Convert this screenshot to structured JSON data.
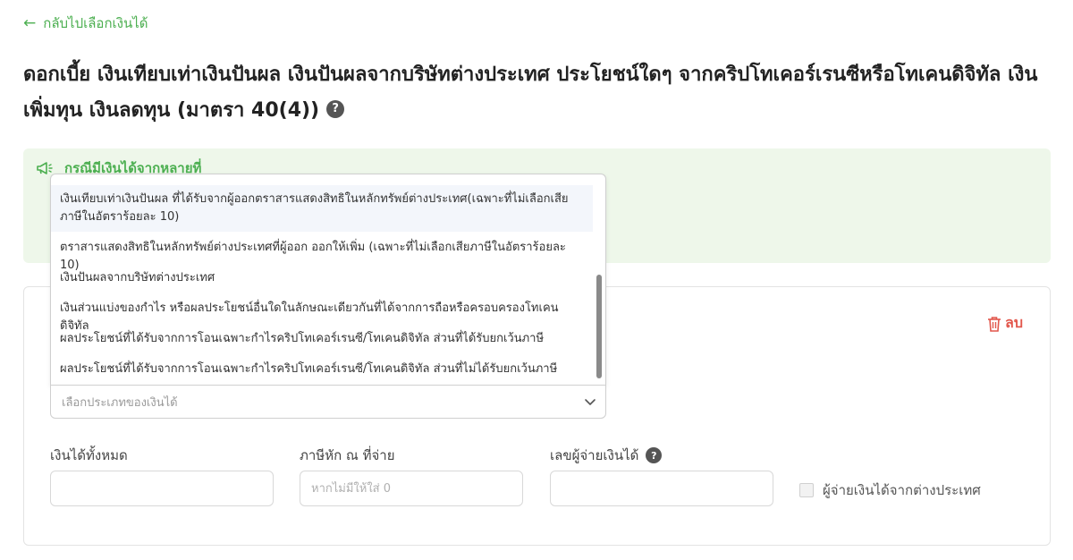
{
  "back_link": {
    "label": "กลับไปเลือกเงินได้"
  },
  "title": "ดอกเบี้ย เงินเทียบเท่าเงินปันผล เงินปันผลจากบริษัทต่างประเทศ ประโยชน์ใดๆ จากคริปโทเคอร์เรนซีหรือโทเคนดิจิทัล เงินเพิ่มทุน เงินลดทุน (มาตรา 40(4))",
  "notice": {
    "heading": "กรณีมีเงินได้จากหลายที่"
  },
  "card": {
    "delete_label": "ลบ"
  },
  "income_type": {
    "placeholder": "เลือกประเภทของเงินได้",
    "options": [
      "เงินเทียบเท่าเงินปันผล ที่ได้รับจากผู้ออกตราสารแสดงสิทธิในหลักทรัพย์ต่างประเทศ(เฉพาะที่ไม่เลือกเสียภาษีในอัตราร้อยละ 10)",
      "ตราสารแสดงสิทธิในหลักทรัพย์ต่างประเทศที่ผู้ออก ออกให้เพิ่ม (เฉพาะที่ไม่เลือกเสียภาษีในอัตราร้อยละ 10)",
      "เงินปันผลจากบริษัทต่างประเทศ",
      "เงินส่วนแบ่งของกำไร หรือผลประโยชน์อื่นใดในลักษณะเดียวกันที่ได้จากการถือหรือครอบครองโทเคนดิจิทัล",
      "ผลประโยชน์ที่ได้รับจากการโอนเฉพาะกำไรคริปโทเคอร์เรนซี/โทเคนดิจิทัล ส่วนที่ได้รับยกเว้นภาษี",
      "ผลประโยชน์ที่ได้รับจากการโอนเฉพาะกำไรคริปโทเคอร์เรนซี/โทเคนดิจิทัล ส่วนที่ไม่ได้รับยกเว้นภาษี"
    ]
  },
  "fields": {
    "total_income_label": "เงินได้ทั้งหมด",
    "total_income_value": "",
    "withholding_label": "ภาษีหัก ณ ที่จ่าย",
    "withholding_placeholder": "หากไม่มีให้ใส่ 0",
    "payer_id_label": "เลขผู้จ่ายเงินได้",
    "payer_id_value": "",
    "foreign_payer_label": "ผู้จ่ายเงินได้จากต่างประเทศ"
  },
  "colors": {
    "accent": "#4caf50",
    "danger": "#e2574c",
    "notice_bg": "#eef7ea"
  }
}
